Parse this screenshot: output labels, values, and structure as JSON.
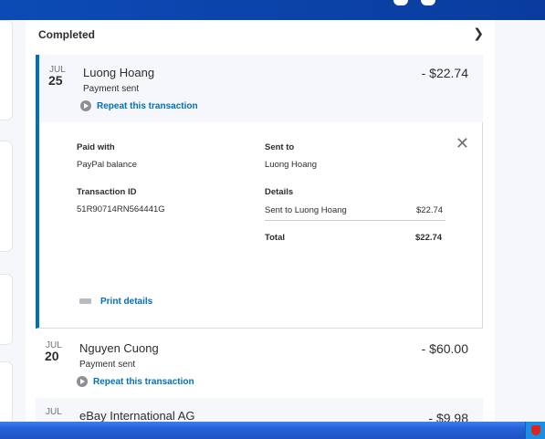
{
  "section": {
    "title": "Completed"
  },
  "transactions": [
    {
      "month": "JUL",
      "day": "25",
      "name": "Luong Hoang",
      "status": "Payment sent",
      "amount": "- $22.74",
      "repeat_label": "Repeat this transaction",
      "details": {
        "paid_with_label": "Paid with",
        "paid_with_value": "PayPal balance",
        "sent_to_label": "Sent to",
        "sent_to_value": "Luong Hoang",
        "transaction_id_label": "Transaction ID",
        "transaction_id_value": "51R90714RN564441G",
        "details_label": "Details",
        "line_item_label": "Sent to Luong Hoang",
        "line_item_amount": "$22.74",
        "total_label": "Total",
        "total_amount": "$22.74",
        "print_label": "Print details",
        "close_symbol": "✕"
      }
    },
    {
      "month": "JUL",
      "day": "20",
      "name": "Nguyen Cuong",
      "status": "Payment sent",
      "amount": "- $60.00",
      "repeat_label": "Repeat this transaction"
    },
    {
      "month": "JUL",
      "day": "",
      "name": "eBay International AG",
      "amount": "- $9.98"
    }
  ],
  "icons": {
    "chevron": "chevron-right-icon",
    "repeat": "repeat-icon",
    "print": "printer-icon",
    "close": "close-icon"
  },
  "colors": {
    "accent": "#0070ba",
    "header_bar": "#0c4bb5",
    "taskbar": "#245edb"
  }
}
